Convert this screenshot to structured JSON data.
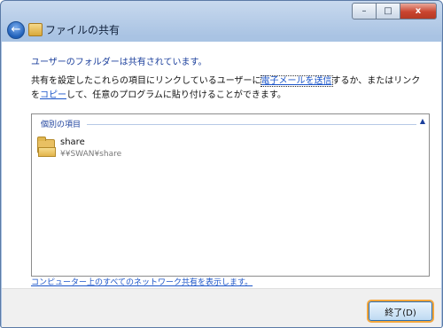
{
  "window": {
    "title": "ファイルの共有",
    "controls": {
      "minimize": "–",
      "maximize": "□",
      "close": "x"
    }
  },
  "back_glyph": "←",
  "message": "ユーザーのフォルダーは共有されています。",
  "description": {
    "part1": "共有を設定したこれらの項目にリンクしているユーザーに",
    "link_email": "電子メールを送信",
    "part2": "するか、またはリンクを",
    "link_copy": "コピー",
    "part3": "して、任意のプログラムに貼り付けることができます。"
  },
  "group": {
    "title": "個別の項目",
    "collapse_glyph": "▲",
    "items": [
      {
        "name": "share",
        "path": "¥¥SWAN¥share"
      }
    ]
  },
  "footer_link": "コンピューター上のすべてのネットワーク共有を表示します。",
  "done_button": "終了(D)",
  "colors": {
    "accent": "#1b3f9c",
    "link": "#1b55c9",
    "focus": "#f3a63c"
  }
}
